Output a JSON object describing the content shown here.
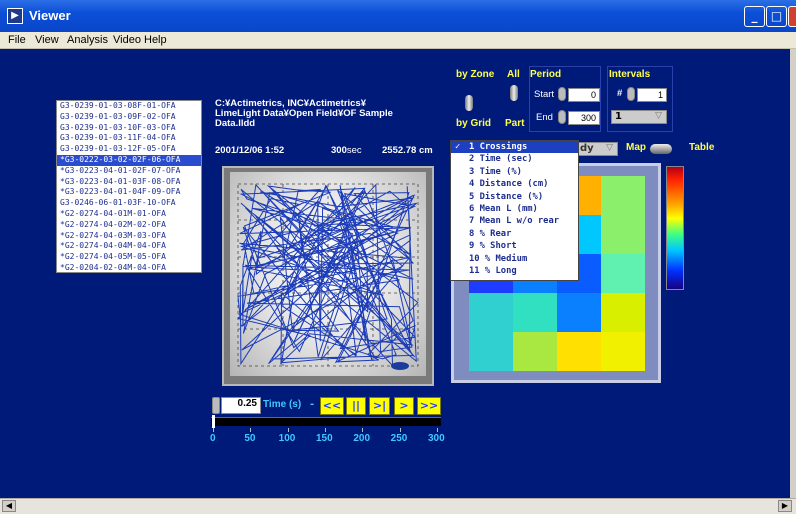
{
  "window": {
    "title": "Viewer",
    "min": "_",
    "max": "□",
    "close": "×",
    "icon": "▶"
  },
  "menu": [
    "File",
    "View",
    "Analysis",
    "Video",
    "Help"
  ],
  "files": [
    "G3-0239-01-03-08F-01-OFA",
    "G3-0239-01-03-09F-02-OFA",
    "G3-0239-01-03-10F-03-OFA",
    "G3-0239-01-03-11F-04-OFA",
    "G3-0239-01-03-12F-05-OFA",
    "*G3-0222-03-02-02F-06-OFA",
    "*G3-0223-04-01-02F-07-OFA",
    "*G3-0223-04-01-03F-08-OFA",
    "*G3-0223-04-01-04F-09-OFA",
    "G3-0246-06-01-03F-10-OFA",
    "*G2-0274-04-01M-01-OFA",
    "*G2-0274-04-02M-02-OFA",
    "*G2-0274-04-03M-03-OFA",
    "*G2-0274-04-04M-04-OFA",
    "*G2-0274-04-05M-05-OFA",
    "*G2-0204-02-04M-04-OFA"
  ],
  "selected_file_index": 5,
  "path": {
    "line1": "C:¥Actimetrics, INC¥Actimetrics¥",
    "line2": "LimeLight Data¥Open Field¥OF Sample",
    "line3": "Data.lldd"
  },
  "info": {
    "date": "2001/12/06  1:52",
    "duration_num": "300",
    "duration_unit": "sec",
    "distance": "2552.78 cm"
  },
  "controls": {
    "by_zone": "by Zone",
    "by_grid": "by Grid",
    "all": "All",
    "part": "Part",
    "period": "Period",
    "start_label": "Start",
    "start_value": "0",
    "end_label": "End",
    "end_value": "300",
    "intervals": "Intervals",
    "hash": "#",
    "interval_value": "1",
    "interval_select": "1",
    "study_partial": "dy",
    "map": "Map",
    "table": "Table"
  },
  "measure_options": [
    "1 Crossings",
    "2 Time (sec)",
    "3 Time (%)",
    "4 Distance (cm)",
    "5 Distance (%)",
    "6 Mean L (mm)",
    "7 Mean L w/o rear",
    "8 % Rear",
    "9 % Short",
    "10 % Medium",
    "11 % Long"
  ],
  "selected_measure_index": 0,
  "check_mark": "✓",
  "playback": {
    "step_value": "0.25",
    "step_unit": "Time (s)",
    "dot": "-",
    "rewind": "<<",
    "pause": "||",
    "step": ">|",
    "play": ">",
    "fast_forward": ">>",
    "position": 0
  },
  "timeline_ticks": [
    "0",
    "50",
    "100",
    "150",
    "200",
    "250",
    "300"
  ],
  "heatmap_colors": [
    [
      "#1e3cff",
      "#0a5cff",
      "#ffb000",
      "#8cef6c"
    ],
    [
      "#1e3cff",
      "#0aa0ff",
      "#00c8ff",
      "#8cef6c"
    ],
    [
      "#1e3cff",
      "#0a80ff",
      "#0a5cff",
      "#60f0b0"
    ],
    [
      "#30d0d0",
      "#30e0c0",
      "#0a80ff",
      "#d8f000"
    ],
    [
      "#30d0d0",
      "#a8e840",
      "#ffe000",
      "#f0f000"
    ]
  ]
}
